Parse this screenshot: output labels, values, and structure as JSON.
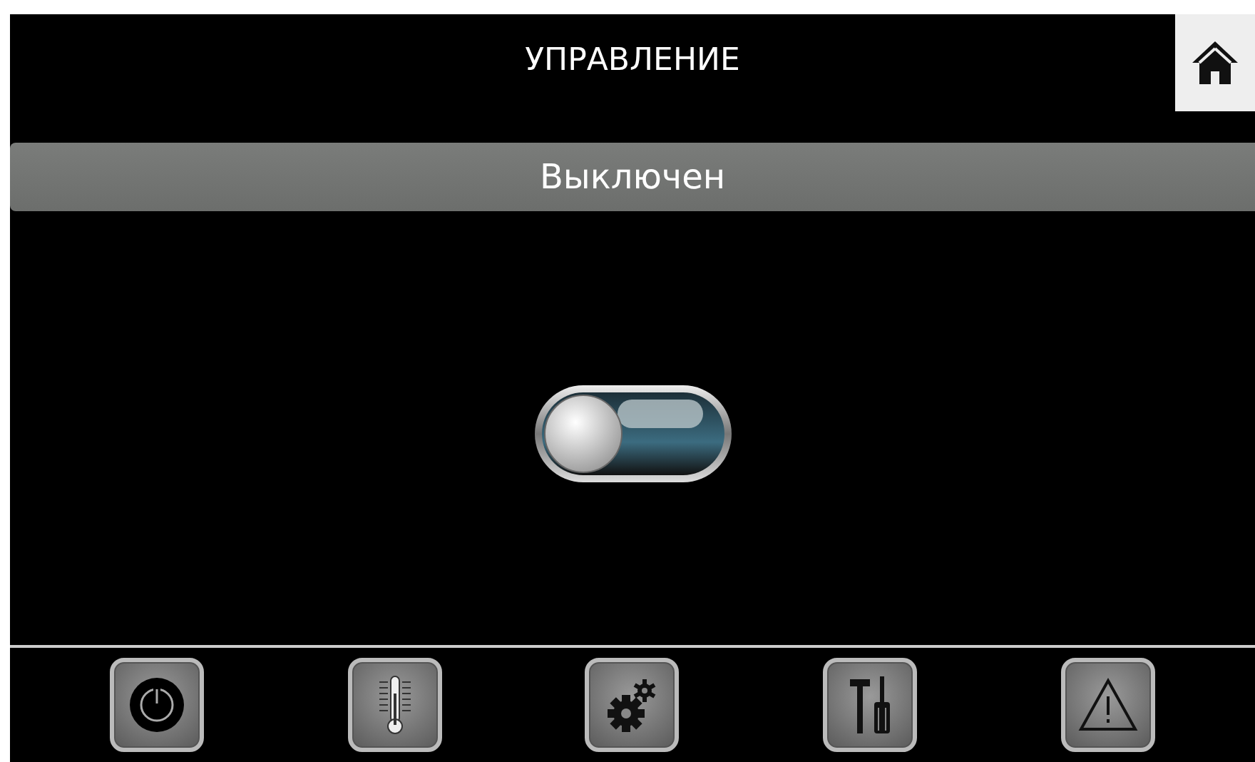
{
  "header": {
    "title": "УПРАВЛЕНИЕ"
  },
  "status": {
    "text": "Выключен"
  },
  "toggle": {
    "on": false
  },
  "nav_buttons": [
    {
      "kind": "power"
    },
    {
      "kind": "thermometer"
    },
    {
      "kind": "gears"
    },
    {
      "kind": "tools"
    },
    {
      "kind": "warning"
    }
  ]
}
